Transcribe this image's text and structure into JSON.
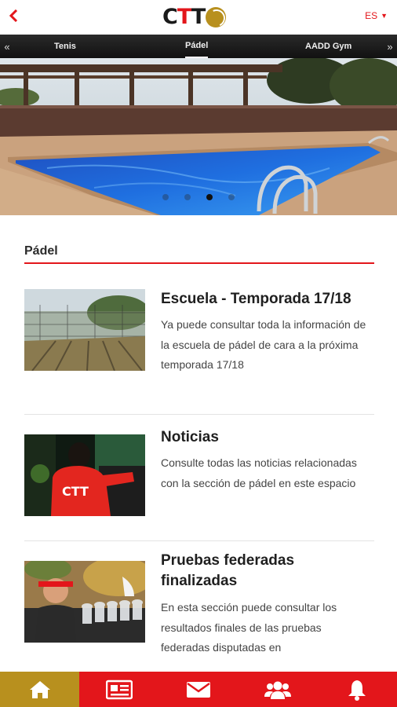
{
  "header": {
    "back_icon": "chevron-left-icon",
    "logo_letters": [
      "C",
      "T",
      "T"
    ],
    "language": "ES"
  },
  "tabs": {
    "items": [
      {
        "label": "Tenis",
        "active": false
      },
      {
        "label": "Pádel",
        "active": true
      },
      {
        "label": "AADD Gym",
        "active": false
      }
    ],
    "left_arrow": "«",
    "right_arrow": "»"
  },
  "carousel": {
    "slide_count": 4,
    "active_index": 2
  },
  "section": {
    "title": "Pádel"
  },
  "articles": [
    {
      "title": "Escuela - Temporada 17/18",
      "description": "Ya puede consultar toda la información de la escuela de pádel de cara a la próxima temporada 17/18"
    },
    {
      "title": "Noticias",
      "description": "Consulte todas las noticias relacionadas con la sección de pádel en este espacio"
    },
    {
      "title": "Pruebas federadas finalizadas",
      "description": "En esta sección puede consultar los resultados finales de las pruebas federadas disputadas en"
    }
  ],
  "bottom_nav": [
    {
      "icon": "home-icon",
      "active": true
    },
    {
      "icon": "newspaper-icon",
      "active": false
    },
    {
      "icon": "mail-icon",
      "active": false
    },
    {
      "icon": "users-icon",
      "active": false
    },
    {
      "icon": "bell-icon",
      "active": false
    }
  ],
  "colors": {
    "accent_red": "#e3161b",
    "accent_gold": "#b8901e",
    "tabbar_dark": "#1a1a1a"
  }
}
